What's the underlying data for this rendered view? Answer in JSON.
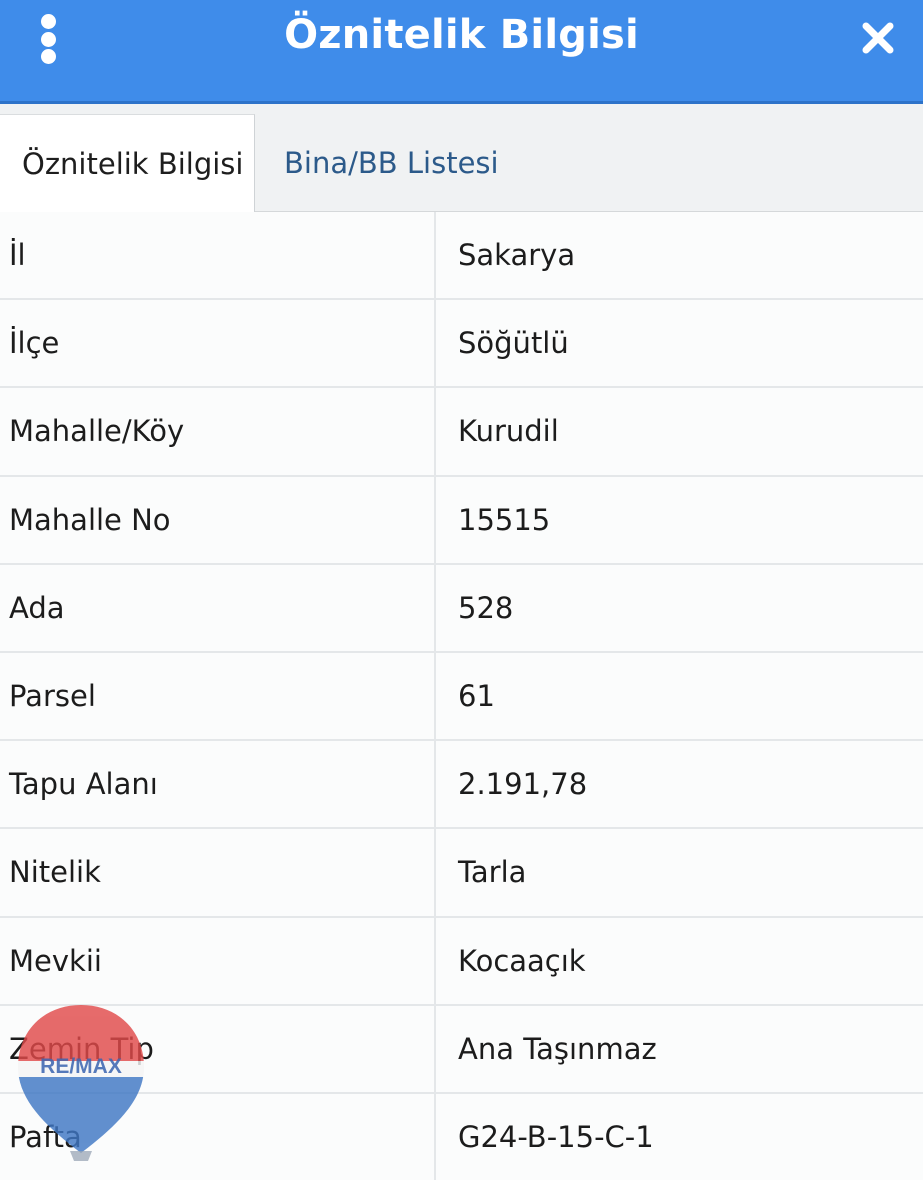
{
  "header": {
    "title": "Öznitelik Bilgisi",
    "menu_icon": "kebab-menu-icon",
    "close_icon": "close-icon",
    "background_color": "#3f8cea"
  },
  "tabs": [
    {
      "label": "Öznitelik Bilgisi",
      "active": true
    },
    {
      "label": "Bina/BB Listesi",
      "active": false
    }
  ],
  "attributes": [
    {
      "key": "İl",
      "value": "Sakarya"
    },
    {
      "key": "İlçe",
      "value": "Söğütlü"
    },
    {
      "key": "Mahalle/Köy",
      "value": "Kurudil"
    },
    {
      "key": "Mahalle No",
      "value": "15515"
    },
    {
      "key": "Ada",
      "value": "528"
    },
    {
      "key": "Parsel",
      "value": "61"
    },
    {
      "key": "Tapu Alanı",
      "value": "2.191,78"
    },
    {
      "key": "Nitelik",
      "value": "Tarla"
    },
    {
      "key": "Mevkii",
      "value": "Kocaaçık"
    },
    {
      "key": "Zemin Tip",
      "value": "Ana Taşınmaz"
    },
    {
      "key": "Pafta",
      "value": "G24-B-15-C-1"
    }
  ],
  "overlay_logo": {
    "text": "RE/MAX",
    "icon": "balloon-logo-icon"
  }
}
